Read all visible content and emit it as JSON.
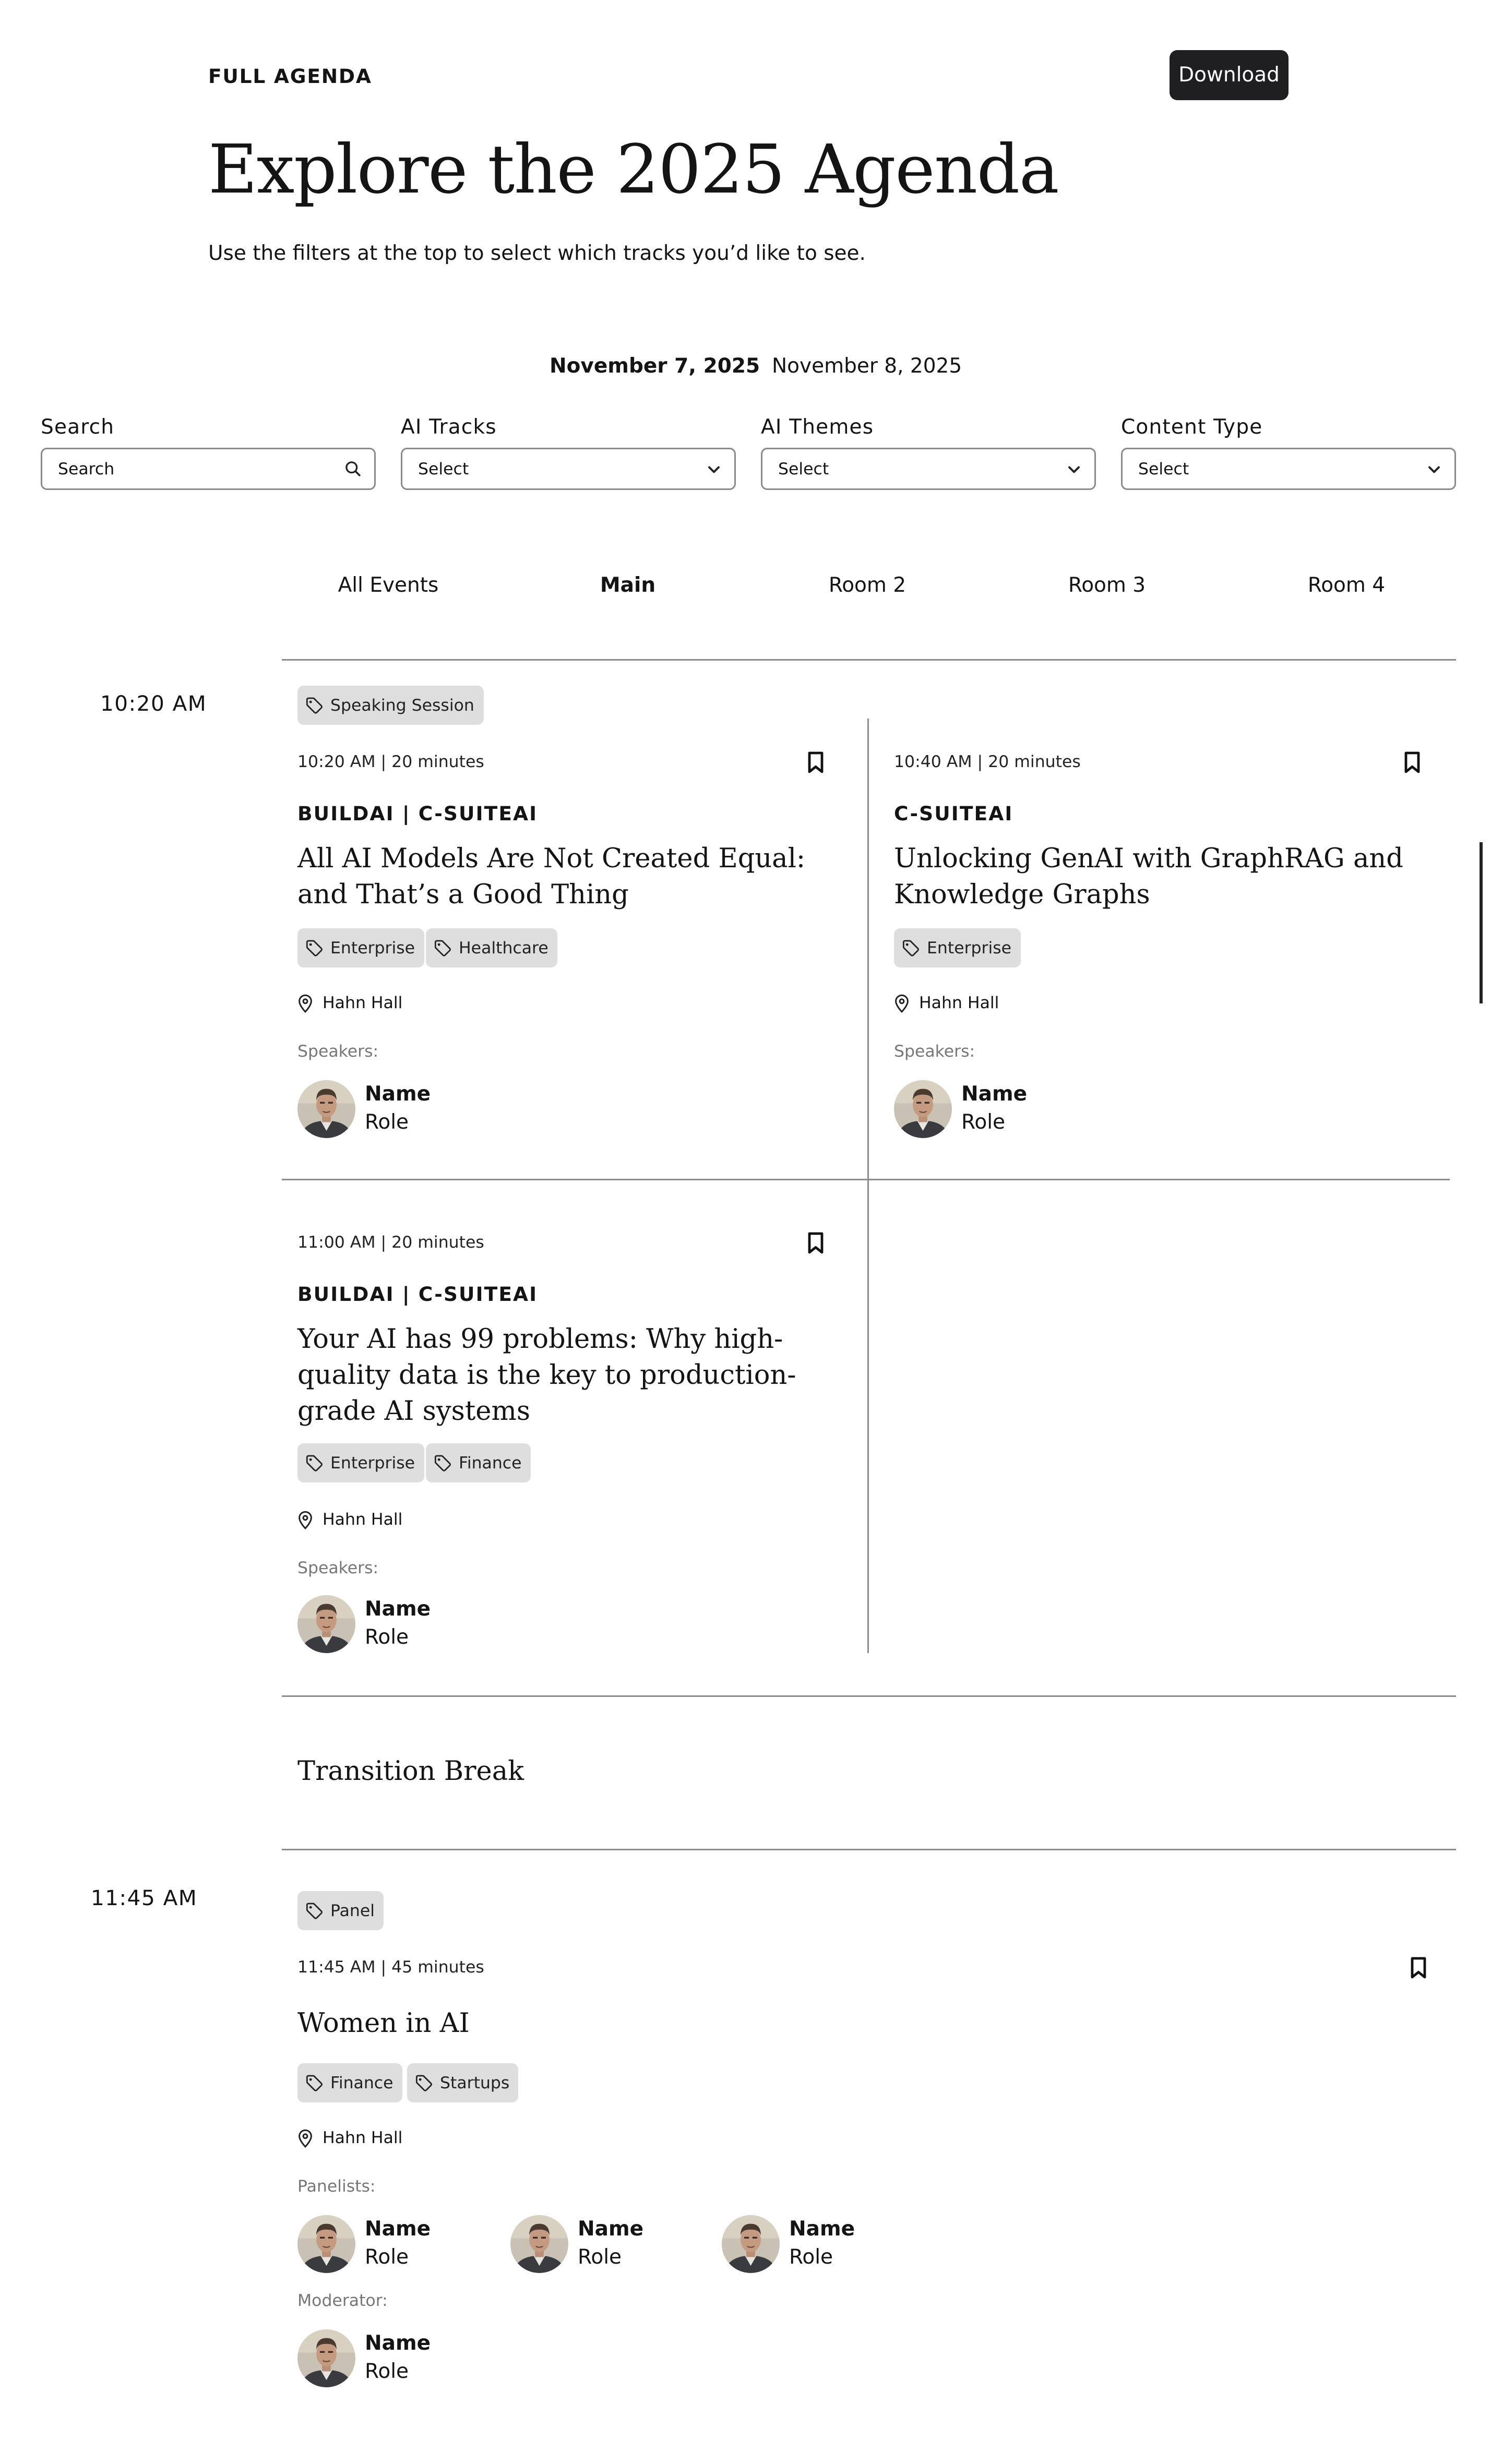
{
  "header": {
    "eyebrow": "FULL AGENDA",
    "download_label": "Download",
    "title": "Explore the 2025 Agenda",
    "lead": "Use the filters at the top to select which tracks you’d like to see."
  },
  "dates": [
    {
      "label": "November 7, 2025",
      "active": true
    },
    {
      "label": "November 8, 2025",
      "active": false
    }
  ],
  "filters": {
    "search": {
      "label": "Search",
      "placeholder": "Search"
    },
    "tracks": {
      "label": "AI Tracks",
      "value": "Select"
    },
    "themes": {
      "label": "AI Themes",
      "value": "Select"
    },
    "content_type": {
      "label": "Content Type",
      "value": "Select"
    }
  },
  "rooms": [
    {
      "label": "All Events",
      "active": false
    },
    {
      "label": "Main",
      "active": true
    },
    {
      "label": "Room 2",
      "active": false
    },
    {
      "label": "Room 3",
      "active": false
    },
    {
      "label": "Room 4",
      "active": false
    }
  ],
  "slot1": {
    "time": "10:20 AM",
    "type_tag": "Speaking Session",
    "sessions": [
      {
        "meta": "10:20 AM | 20 minutes",
        "track": "BUILDAI | C-SUITEAI",
        "title": "All AI Models Are Not Created Equal: and That’s a Good Thing",
        "tags": [
          "Enterprise",
          "Healthcare"
        ],
        "location": "Hahn Hall",
        "speakers_label": "Speakers:",
        "speaker": {
          "name": "Name",
          "role": "Role"
        }
      },
      {
        "meta": "10:40 AM | 20 minutes",
        "track": "C-SUITEAI",
        "title": "Unlocking GenAI with GraphRAG and Knowledge Graphs",
        "tags": [
          "Enterprise"
        ],
        "location": "Hahn Hall",
        "speakers_label": "Speakers:",
        "speaker": {
          "name": "Name",
          "role": "Role"
        }
      },
      {
        "meta": "11:00 AM | 20 minutes",
        "track": "BUILDAI | C-SUITEAI",
        "title": "Your AI has 99 problems: Why high-quality data is the key to production-grade AI systems",
        "tags": [
          "Enterprise",
          "Finance"
        ],
        "location": "Hahn Hall",
        "speakers_label": "Speakers:",
        "speaker": {
          "name": "Name",
          "role": "Role"
        }
      }
    ]
  },
  "break": {
    "label": "Transition Break"
  },
  "slot2": {
    "time": "11:45 AM",
    "type_tag": "Panel",
    "session": {
      "meta": "11:45 AM | 45 minutes",
      "title": "Women in AI",
      "tags": [
        "Finance",
        "Startups"
      ],
      "location": "Hahn Hall",
      "panelists_label": "Panelists:",
      "panelists": [
        {
          "name": "Name",
          "role": "Role"
        },
        {
          "name": "Name",
          "role": "Role"
        },
        {
          "name": "Name",
          "role": "Role"
        }
      ],
      "moderator_label": "Moderator:",
      "moderator": {
        "name": "Name",
        "role": "Role"
      }
    }
  },
  "colors": {
    "ink": "#141414",
    "button_bg": "#1f1f22",
    "tag_bg": "#dedede",
    "rule": "#8c8c8c",
    "muted": "#777777"
  },
  "icons": [
    "search-icon",
    "chevron-down-icon",
    "tag-icon",
    "bookmark-icon",
    "location-pin-icon"
  ]
}
